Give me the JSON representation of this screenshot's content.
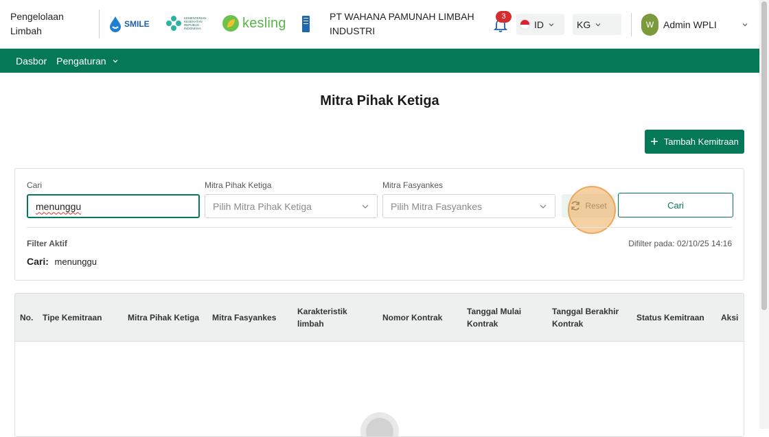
{
  "header": {
    "app_title": "Pengelolaan Limbah",
    "logos": {
      "smile": "SMILE",
      "kemenkes": "KEMENTERIAN KESEHATAN REPUBLIK INDONESIA",
      "kesling": "kesling"
    },
    "company": "PT WAHANA PAMUNAH LIMBAH INDUSTRI",
    "notifications_count": "3",
    "language": "ID",
    "unit": "KG",
    "user": {
      "initial": "W",
      "name": "Admin WPLI"
    }
  },
  "nav": {
    "items": [
      "Dasbor",
      "Pengaturan"
    ]
  },
  "page": {
    "title": "Mitra Pihak Ketiga",
    "add_button": "Tambah Kemitraan"
  },
  "filters": {
    "search_label": "Cari",
    "search_value": "menunggu",
    "partner_label": "Mitra Pihak Ketiga",
    "partner_placeholder": "Pilih Mitra Pihak Ketiga",
    "facility_label": "Mitra Fasyankes",
    "facility_placeholder": "Pilih Mitra Fasyankes",
    "reset_button": "Reset",
    "search_button": "Cari",
    "active_filters_label": "Filter Aktif",
    "filtered_at": "Difilter pada: 02/10/25 14:16",
    "active_key": "Cari:",
    "active_value": "menunggu"
  },
  "table": {
    "columns": [
      "No.",
      "Tipe Kemitraan",
      "Mitra Pihak Ketiga",
      "Mitra Fasyankes",
      "Karakteristik limbah",
      "Nomor Kontrak",
      "Tanggal Mulai Kontrak",
      "Tanggal Berakhir Kontrak",
      "Status Kemitraan",
      "Aksi"
    ]
  },
  "colors": {
    "primary": "#047857",
    "badge": "#d32f2f",
    "highlight": "#f0aa5a"
  }
}
